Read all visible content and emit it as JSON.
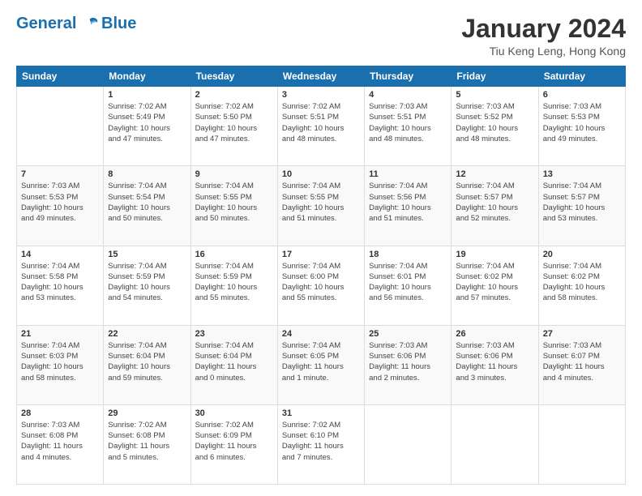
{
  "header": {
    "logo_line1": "General",
    "logo_line2": "Blue",
    "month_title": "January 2024",
    "location": "Tiu Keng Leng, Hong Kong"
  },
  "weekdays": [
    "Sunday",
    "Monday",
    "Tuesday",
    "Wednesday",
    "Thursday",
    "Friday",
    "Saturday"
  ],
  "weeks": [
    [
      {
        "day": "",
        "info": ""
      },
      {
        "day": "1",
        "info": "Sunrise: 7:02 AM\nSunset: 5:49 PM\nDaylight: 10 hours\nand 47 minutes."
      },
      {
        "day": "2",
        "info": "Sunrise: 7:02 AM\nSunset: 5:50 PM\nDaylight: 10 hours\nand 47 minutes."
      },
      {
        "day": "3",
        "info": "Sunrise: 7:02 AM\nSunset: 5:51 PM\nDaylight: 10 hours\nand 48 minutes."
      },
      {
        "day": "4",
        "info": "Sunrise: 7:03 AM\nSunset: 5:51 PM\nDaylight: 10 hours\nand 48 minutes."
      },
      {
        "day": "5",
        "info": "Sunrise: 7:03 AM\nSunset: 5:52 PM\nDaylight: 10 hours\nand 48 minutes."
      },
      {
        "day": "6",
        "info": "Sunrise: 7:03 AM\nSunset: 5:53 PM\nDaylight: 10 hours\nand 49 minutes."
      }
    ],
    [
      {
        "day": "7",
        "info": "Sunrise: 7:03 AM\nSunset: 5:53 PM\nDaylight: 10 hours\nand 49 minutes."
      },
      {
        "day": "8",
        "info": "Sunrise: 7:04 AM\nSunset: 5:54 PM\nDaylight: 10 hours\nand 50 minutes."
      },
      {
        "day": "9",
        "info": "Sunrise: 7:04 AM\nSunset: 5:55 PM\nDaylight: 10 hours\nand 50 minutes."
      },
      {
        "day": "10",
        "info": "Sunrise: 7:04 AM\nSunset: 5:55 PM\nDaylight: 10 hours\nand 51 minutes."
      },
      {
        "day": "11",
        "info": "Sunrise: 7:04 AM\nSunset: 5:56 PM\nDaylight: 10 hours\nand 51 minutes."
      },
      {
        "day": "12",
        "info": "Sunrise: 7:04 AM\nSunset: 5:57 PM\nDaylight: 10 hours\nand 52 minutes."
      },
      {
        "day": "13",
        "info": "Sunrise: 7:04 AM\nSunset: 5:57 PM\nDaylight: 10 hours\nand 53 minutes."
      }
    ],
    [
      {
        "day": "14",
        "info": "Sunrise: 7:04 AM\nSunset: 5:58 PM\nDaylight: 10 hours\nand 53 minutes."
      },
      {
        "day": "15",
        "info": "Sunrise: 7:04 AM\nSunset: 5:59 PM\nDaylight: 10 hours\nand 54 minutes."
      },
      {
        "day": "16",
        "info": "Sunrise: 7:04 AM\nSunset: 5:59 PM\nDaylight: 10 hours\nand 55 minutes."
      },
      {
        "day": "17",
        "info": "Sunrise: 7:04 AM\nSunset: 6:00 PM\nDaylight: 10 hours\nand 55 minutes."
      },
      {
        "day": "18",
        "info": "Sunrise: 7:04 AM\nSunset: 6:01 PM\nDaylight: 10 hours\nand 56 minutes."
      },
      {
        "day": "19",
        "info": "Sunrise: 7:04 AM\nSunset: 6:02 PM\nDaylight: 10 hours\nand 57 minutes."
      },
      {
        "day": "20",
        "info": "Sunrise: 7:04 AM\nSunset: 6:02 PM\nDaylight: 10 hours\nand 58 minutes."
      }
    ],
    [
      {
        "day": "21",
        "info": "Sunrise: 7:04 AM\nSunset: 6:03 PM\nDaylight: 10 hours\nand 58 minutes."
      },
      {
        "day": "22",
        "info": "Sunrise: 7:04 AM\nSunset: 6:04 PM\nDaylight: 10 hours\nand 59 minutes."
      },
      {
        "day": "23",
        "info": "Sunrise: 7:04 AM\nSunset: 6:04 PM\nDaylight: 11 hours\nand 0 minutes."
      },
      {
        "day": "24",
        "info": "Sunrise: 7:04 AM\nSunset: 6:05 PM\nDaylight: 11 hours\nand 1 minute."
      },
      {
        "day": "25",
        "info": "Sunrise: 7:03 AM\nSunset: 6:06 PM\nDaylight: 11 hours\nand 2 minutes."
      },
      {
        "day": "26",
        "info": "Sunrise: 7:03 AM\nSunset: 6:06 PM\nDaylight: 11 hours\nand 3 minutes."
      },
      {
        "day": "27",
        "info": "Sunrise: 7:03 AM\nSunset: 6:07 PM\nDaylight: 11 hours\nand 4 minutes."
      }
    ],
    [
      {
        "day": "28",
        "info": "Sunrise: 7:03 AM\nSunset: 6:08 PM\nDaylight: 11 hours\nand 4 minutes."
      },
      {
        "day": "29",
        "info": "Sunrise: 7:02 AM\nSunset: 6:08 PM\nDaylight: 11 hours\nand 5 minutes."
      },
      {
        "day": "30",
        "info": "Sunrise: 7:02 AM\nSunset: 6:09 PM\nDaylight: 11 hours\nand 6 minutes."
      },
      {
        "day": "31",
        "info": "Sunrise: 7:02 AM\nSunset: 6:10 PM\nDaylight: 11 hours\nand 7 minutes."
      },
      {
        "day": "",
        "info": ""
      },
      {
        "day": "",
        "info": ""
      },
      {
        "day": "",
        "info": ""
      }
    ]
  ]
}
